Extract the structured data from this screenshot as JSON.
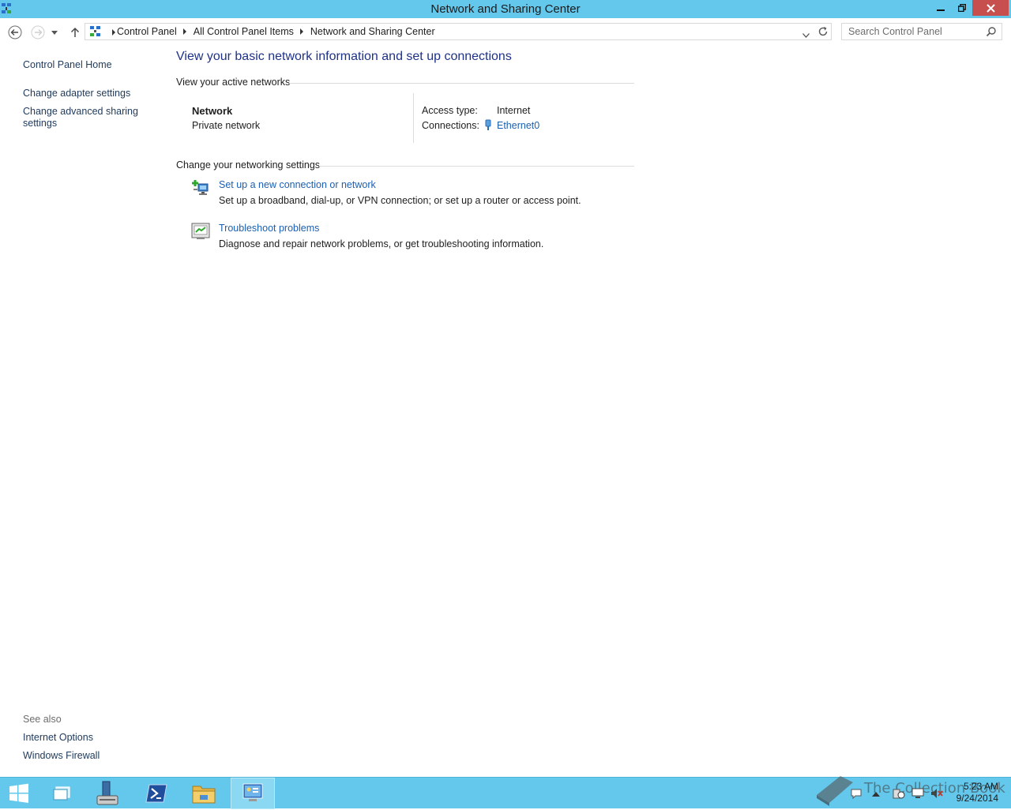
{
  "window": {
    "title": "Network and Sharing Center"
  },
  "address": {
    "crumbs": [
      "Control Panel",
      "All Control Panel Items",
      "Network and Sharing Center"
    ]
  },
  "search": {
    "placeholder": "Search Control Panel"
  },
  "left_pane": {
    "home": "Control Panel Home",
    "adapter": "Change adapter settings",
    "advanced_line1": "Change advanced sharing",
    "advanced_line2": "settings",
    "see_also": "See also",
    "internet_options": "Internet Options",
    "firewall": "Windows Firewall"
  },
  "main": {
    "heading": "View your basic network information and set up connections",
    "active_networks": "View your active networks",
    "network": {
      "name": "Network",
      "type": "Private network",
      "access_label": "Access type:",
      "access_value": "Internet",
      "connections_label": "Connections:",
      "connection_value": "Ethernet0"
    },
    "change_settings": "Change your networking settings",
    "tasks": [
      {
        "title": "Set up a new connection or network",
        "desc": "Set up a broadband, dial-up, or VPN connection; or set up a router or access point."
      },
      {
        "title": "Troubleshoot problems",
        "desc": "Diagnose and repair network problems, or get troubleshooting information."
      }
    ]
  },
  "taskbar": {
    "time": "5:23 AM",
    "date": "9/24/2014",
    "watermark": "The Collection Book"
  },
  "colors": {
    "titlebar": "#64c8ec",
    "close": "#c7504f",
    "link": "#1c5fb0",
    "heading": "#1e3287"
  }
}
